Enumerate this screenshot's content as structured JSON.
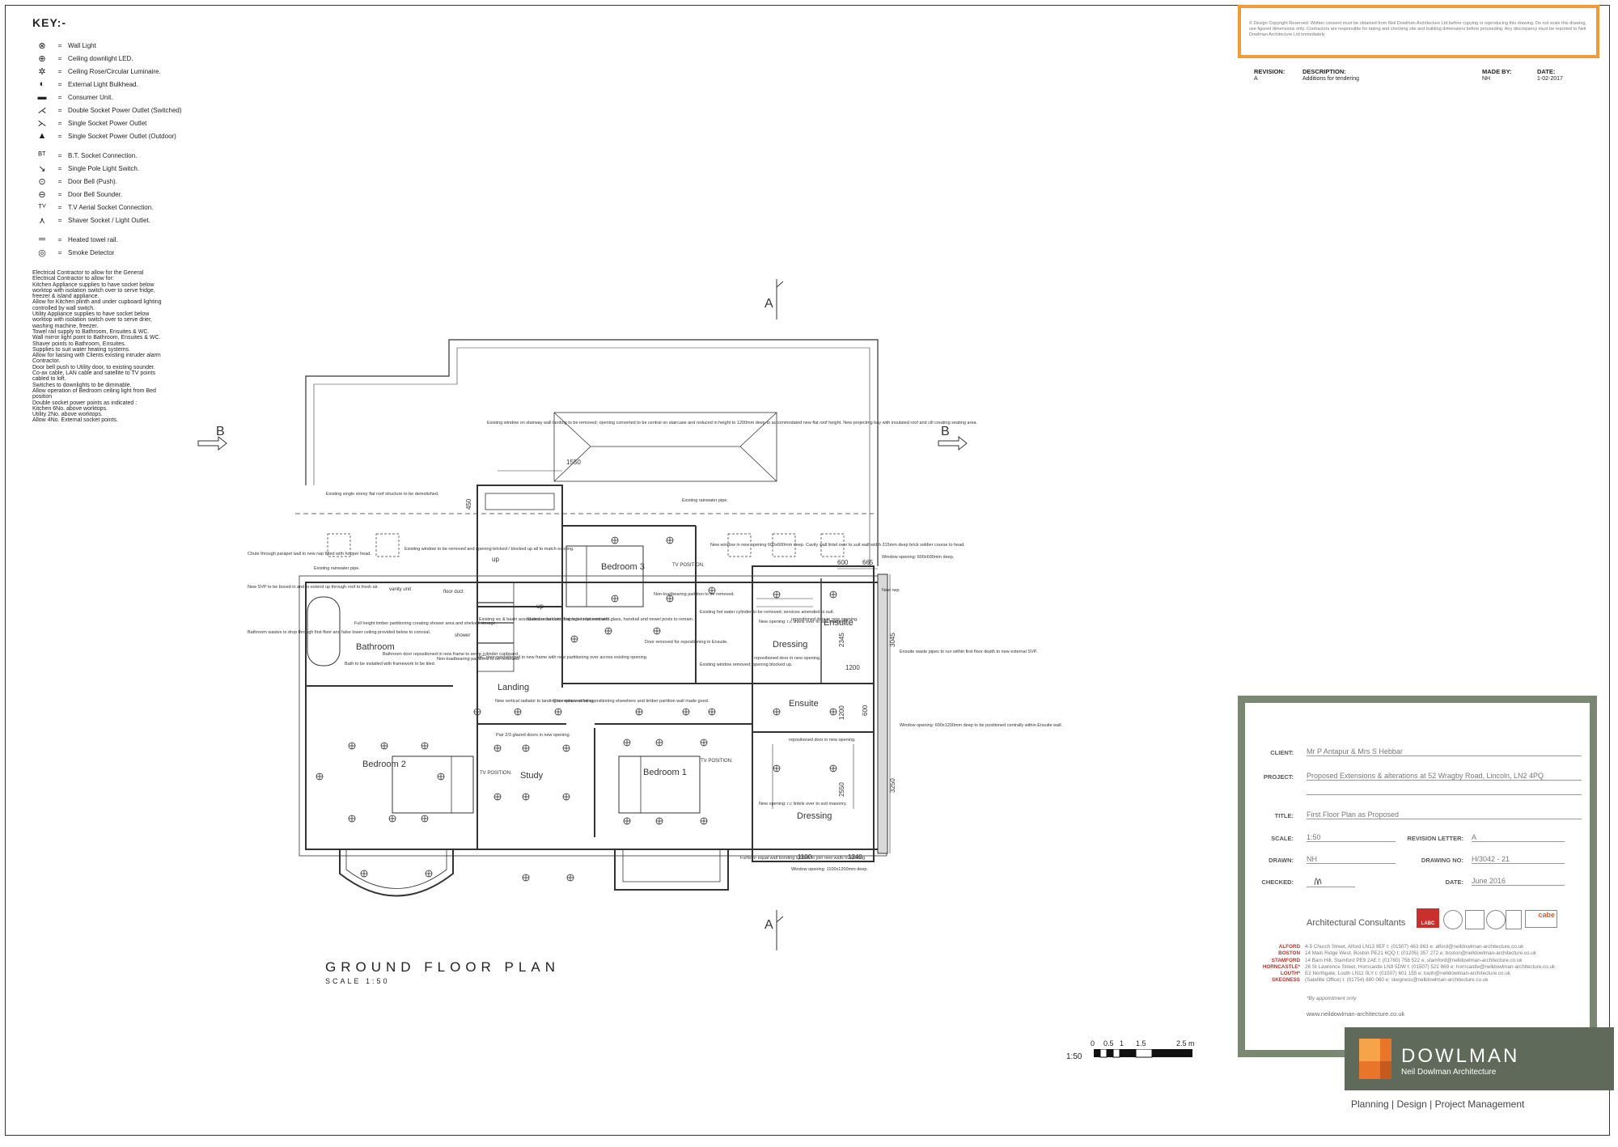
{
  "key": {
    "title": "KEY:-",
    "items": [
      {
        "symbol": "⊗",
        "label": "Wall Light",
        "icon": "wall-light-icon"
      },
      {
        "symbol": "⊕",
        "label": "Ceiling downlight LED.",
        "icon": "ceiling-downlight-icon"
      },
      {
        "symbol": "✲",
        "label": "Ceiling Rose/Circular Luminaire.",
        "icon": "ceiling-rose-icon"
      },
      {
        "symbol": "◐",
        "label": "External Light Bulkhead.",
        "icon": "bulkhead-light-icon"
      },
      {
        "symbol": "▬",
        "label": "Consumer Unit.",
        "icon": "consumer-unit-icon"
      },
      {
        "symbol": "⋌",
        "label": "Double Socket Power Outlet (Switched)",
        "icon": "double-socket-icon"
      },
      {
        "symbol": "⋋",
        "label": "Single Socket Power Outlet",
        "icon": "single-socket-icon"
      },
      {
        "symbol": "▲",
        "label": "Single Socket Power Outlet (Outdoor)",
        "icon": "outdoor-socket-icon"
      },
      {
        "symbol": "ᴮᵀ",
        "label": "B.T. Socket Connection.",
        "icon": "bt-socket-icon"
      },
      {
        "symbol": "↘",
        "label": "Single Pole Light Switch.",
        "icon": "light-switch-icon"
      },
      {
        "symbol": "⊙",
        "label": "Door Bell (Push).",
        "icon": "door-bell-push-icon"
      },
      {
        "symbol": "⊖",
        "label": "Door Bell Sounder.",
        "icon": "door-bell-sounder-icon"
      },
      {
        "symbol": "ᵀⱽ",
        "label": "T.V Aerial Socket Connection.",
        "icon": "tv-aerial-icon"
      },
      {
        "symbol": "⋏",
        "label": "Shaver Socket / Light Outlet.",
        "icon": "shaver-socket-icon"
      },
      {
        "symbol": "═",
        "label": "Heated towel rail.",
        "icon": "towel-rail-icon"
      },
      {
        "symbol": "◎",
        "label": "Smoke Detector",
        "icon": "smoke-detector-icon"
      }
    ],
    "notes": "Electrical Contractor to allow for the General\nElectrical Contractor to allow for:\nKitchen Appliance supplies to have socket below worktop with isolation switch over to serve fridge, freezer & island appliance.\nAllow for Kitchen plinth and under cupboard lighting controlled by wall switch.\nUtility Appliance supplies to have socket below worktop with isolation switch over to serve drier, washing machine, freezer.\nTowel rail supply to Bathroom, Ensuites & WC.\nWall mirror light point to Bathroom, Ensuites & WC.\nShaver points to Bathroom, Ensuites.\nSupplies to suit water heating systems.\nAllow for liaising with Clients existing intruder alarm Contractor.\nDoor bell push to Utility door, to existing sounder.\nCo-ax cable, LAN cable and satellite to TV points cabled to loft.\nSwitches to downlights to be dimmable.\nAllow operation of Bedroom ceiling light from Bed position\nDouble socket power points as indicated :\nKitchen 6No. above worktops.\nUtility 2No. above worktops.\nAllow 4No. External socket points."
  },
  "plan": {
    "title": "GROUND FLOOR PLAN",
    "scale": "SCALE 1:50",
    "section_a": "A",
    "section_b": "B",
    "rooms": {
      "bedroom3": "Bedroom 3",
      "bedroom2": "Bedroom 2",
      "bedroom1": "Bedroom 1",
      "bathroom": "Bathroom",
      "landing": "Landing",
      "study": "Study",
      "ensuite_top": "Ensuite",
      "ensuite_mid": "Ensuite",
      "dressing_top": "Dressing",
      "dressing_bottom": "Dressing"
    },
    "labels": {
      "up1": "up",
      "up2": "up",
      "tv1": "TV POSITION.",
      "tv2": "TV POSITION.",
      "tv3": "TV POSITION.",
      "vanity": "vanity unit",
      "shower": "shower",
      "floor_duct": "floor duct"
    },
    "dims": {
      "d1550": "1550",
      "d450": "450",
      "d600a": "600",
      "d665": "665",
      "d3045": "3045",
      "d2345": "2345",
      "d1200a": "1200",
      "d600b": "600",
      "d1200b": "1200",
      "d3250": "3250",
      "d2550": "2550",
      "d1100": "1100",
      "d1240": "1240"
    },
    "annotations": {
      "a1": "Existing window on stairway wall landing to be removed; opening converted to be central on staircase and reduced in height to 1200mm deep to accommodated new flat roof height. New projecting bay with insulated roof and cill creating seating area.",
      "a2": "Existing single storey flat roof structure to be demolished.",
      "a3": "Existing rainwater pipe.",
      "a4": "Existing rainwater pipe.",
      "a5": "Chute through parapet wall to new rwp fitted with hopper head.",
      "a6": "New SVP to be boxed in and to extend up through roof to fresh air.",
      "a7": "Bathroom wastes to drop through first floor and false lower ceiling provided below to conceal.",
      "a8": "Existing window to be removed and opening bricked / blocked up all to match existing.",
      "a9": "Full height timber partitioning creating shower area and shelved storage.",
      "a10": "Bath to be installed with framework to be tiled.",
      "a11": "Bathroom door repositioned in new frame to serve cylinder cupboard.",
      "a12": "Non-loadbearing partitions to be removed.",
      "a13": "Existing wc & basin associated redundant drainage to be removed.",
      "a14": "Staircase balustrading to be replaced with glass, handrail and newel posts to remain.",
      "a15": "WC door repositioned in new frame with new partitioning over across existing opening.",
      "a16": "Non-loadbearing partition to be removed.",
      "a17": "Door removed for repositioning in Ensuite.",
      "a18": "Existing hot water cylinder to be removed; services amended to suit.",
      "a19": "Existing window removed; opening blocked up.",
      "a20": "New window in new opening 600x600mm deep. Cavity wall lintel over to suit wall width 215mm deep brick soldier course to head.",
      "a21": "Window opening: 600x600mm deep.",
      "a22": "New opening: r.c lintels over to suit masonry.",
      "a23": "repositioned door in new opening.",
      "a24": "repositioned door in new opening.",
      "a25": "New rwp.",
      "a26": "Ensuite waste pipes to run within first floor depth to new external SVP.",
      "a27": "Window opening: 600x1200mm deep to be positioned centrally within Ensuite wall.",
      "a28": "New vertical radiator to landing to replace existing.",
      "a29": "Door removed for repositioning elsewhere and timber partition wall made good.",
      "a30": "Pair 2/3 glazed doors in new opening.",
      "a31": "repositioned door in new opening.",
      "a32": "New opening: r.c lintels over to suit masonry.",
      "a33": "Furfix or equal wall bonding system to join new walls to existing.",
      "a34": "Window opening: 1100x1200mm deep."
    }
  },
  "copyright": "© Design Copyright Reserved. Written consent must be obtained from Neil Dowlman Architecture Ltd before copying or reproducing this drawing. Do not scale this drawing, use figured dimensions only. Contractors are responsible for taking and checking site and building dimensions before proceeding. Any discrepancy must be reported to Neil Dowlman Architecture Ltd immediately.",
  "revisions": {
    "headers": {
      "revision": "REVISION:",
      "description": "DESCRIPTION:",
      "made_by": "MADE BY:",
      "date": "DATE:"
    },
    "rows": [
      {
        "revision": "A",
        "description": "Additions for tendering",
        "made_by": "NH",
        "date": "1-02-2017"
      }
    ]
  },
  "title_block": {
    "client_label": "CLIENT:",
    "client": "Mr P Antapur & Mrs S Hebbar",
    "project_label": "PROJECT:",
    "project": "Proposed Extensions & alterations at 52 Wragby Road, Lincoln, LN2 4PQ",
    "title_label": "TITLE:",
    "title": "First Floor Plan as Proposed",
    "scale_label": "SCALE:",
    "scale": "1:50",
    "revision_label": "REVISION LETTER:",
    "revision": "A",
    "drawn_label": "DRAWN:",
    "drawn": "NH",
    "drawing_no_label": "DRAWING NO:",
    "drawing_no": "H/3042 - 21",
    "checked_label": "CHECKED:",
    "date_label": "DATE:",
    "date": "June 2016",
    "consultants": "Architectural Consultants",
    "badge_labc": "LABC",
    "badge_cabe": "cabe",
    "offices": [
      {
        "town": "ALFORD",
        "details": "4-5 Church Street, Alford LN13 9EF  t: (01507) 463 863  e: alford@nelldowlman-architecture.co.uk"
      },
      {
        "town": "BOSTON",
        "details": "14 Main Ridge West, Boston PE21 6QQ  t: (01205) 357 272  e: boston@nelldowlman-architecture.co.uk"
      },
      {
        "town": "STAMFORD",
        "details": "14 Barn Hill, Stamford PE9 2AE  t: (01780) 758 522  e: stamford@nelldowlman-architecture.co.uk"
      },
      {
        "town": "HORNCASTLE*",
        "details": "26 St Lawrence Street, Horncastle LN9 5DW  t: (01507) 522 869  e: horncastle@nelldowlman-architecture.co.uk"
      },
      {
        "town": "LOUTH*",
        "details": "E2 Northgate, Louth LN11 0LY  t: (01507) 601 155  e: louth@nelldowlman-architecture.co.uk"
      },
      {
        "town": "SKEGNESS",
        "details": "(Satellite Office)  t: (01754) 880 060  e: skegness@nelldowlman-architecture.co.uk"
      }
    ],
    "appointment": "*By appointment only",
    "website": "www.neildowlman-architecture.co.uk"
  },
  "brand": {
    "name": "DOWLMAN",
    "sub": "Neil Dowlman Architecture",
    "services": "Planning | Design | Project Management"
  },
  "scalebar": {
    "ratio": "1:50",
    "ticks": [
      "0",
      "0.5",
      "1",
      "1.5",
      "2.5 m"
    ]
  },
  "colors": {
    "accent_orange": "#f19a38",
    "title_block_green": "#7a8771",
    "logo_bg": "#5f6a5b",
    "office_red": "#b5322c"
  }
}
